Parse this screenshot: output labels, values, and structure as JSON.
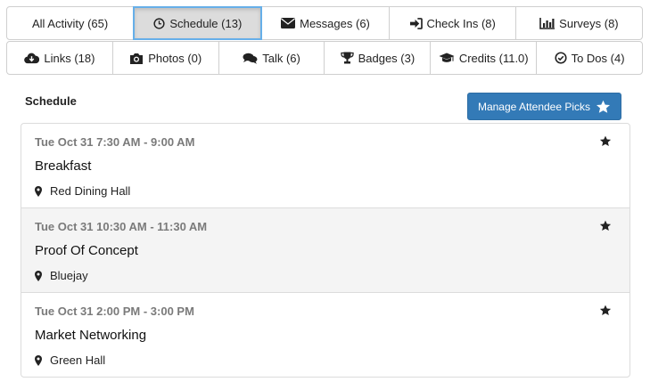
{
  "tabs_row1": [
    {
      "label": "All Activity (65)",
      "icon": ""
    },
    {
      "label": "Schedule (13)",
      "icon": "clock-icon",
      "active": true
    },
    {
      "label": "Messages (6)",
      "icon": "envelope-icon"
    },
    {
      "label": "Check Ins (8)",
      "icon": "sign-in-icon"
    },
    {
      "label": "Surveys (8)",
      "icon": "bar-chart-icon"
    }
  ],
  "tabs_row2": [
    {
      "label": "Links (18)",
      "icon": "cloud-download-icon"
    },
    {
      "label": "Photos (0)",
      "icon": "camera-icon"
    },
    {
      "label": "Talk (6)",
      "icon": "comments-icon"
    },
    {
      "label": "Badges (3)",
      "icon": "trophy-icon"
    },
    {
      "label": "Credits (11.0)",
      "icon": "graduation-cap-icon"
    },
    {
      "label": "To Dos (4)",
      "icon": "check-circle-icon"
    }
  ],
  "schedule": {
    "title": "Schedule",
    "manage_button_label": "Manage Attendee Picks",
    "events": [
      {
        "time": "Tue Oct 31 7:30 AM - 9:00 AM",
        "title": "Breakfast",
        "location": "Red Dining Hall"
      },
      {
        "time": "Tue Oct 31 10:30 AM - 11:30 AM",
        "title": "Proof Of Concept",
        "location": "Bluejay"
      },
      {
        "time": "Tue Oct 31 2:00 PM - 3:00 PM",
        "title": "Market Networking",
        "location": "Green Hall"
      }
    ]
  },
  "colors": {
    "button_blue": "#337ab7",
    "arrow_blue": "#6aa5e6",
    "active_tab_bg": "#dcdcdc",
    "active_tab_border": "#66afe9"
  }
}
